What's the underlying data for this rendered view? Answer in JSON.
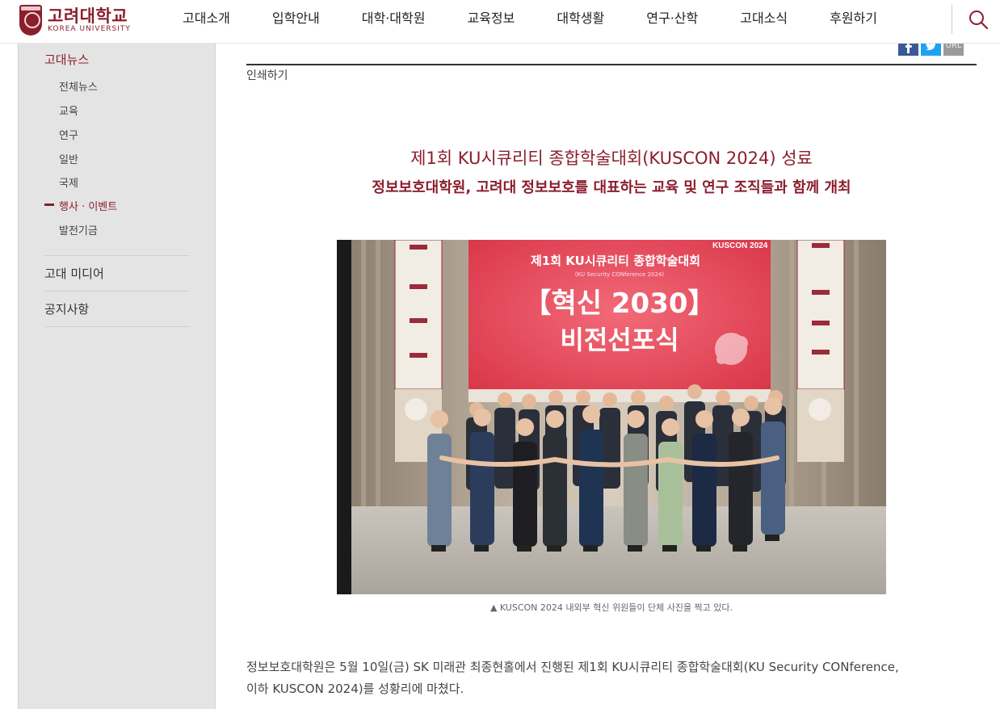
{
  "header": {
    "logo_ko": "고려대학교",
    "logo_en": "KOREA UNIVERSITY",
    "nav": [
      "고대소개",
      "입학안내",
      "대학·대학원",
      "교육정보",
      "대학생활",
      "연구·산학",
      "고대소식",
      "후원하기"
    ],
    "search_icon": "search-icon"
  },
  "sidebar": {
    "heading": "고대뉴스",
    "items": [
      "전체뉴스",
      "교육",
      "연구",
      "일반",
      "국제",
      "행사 · 이벤트",
      "발전기금"
    ],
    "active_item": "행사 · 이벤트",
    "sections": [
      "고대 미디어",
      "공지사항"
    ]
  },
  "article": {
    "print_label": "인쇄하기",
    "share": {
      "url_label": "URL"
    },
    "title": "제1회 KU시큐리티 종합학술대회(KUSCON 2024) 성료",
    "subtitle": "정보보호대학원, 고려대 정보보호를 대표하는 교육 및 연구 조직들과 함께 개최",
    "photo": {
      "screen_title": "제1회 KU시큐리티 종합학술대회",
      "screen_sub": "(KU Security CONference 2024)",
      "screen_brand": "KUSCON 2024",
      "screen_main1": "【혁신 2030】",
      "screen_main2": "비전선포식"
    },
    "caption": "▲ KUSCON 2024 내외부 혁신 위원들이 단체 사진을 찍고 있다.",
    "body_line1": "정보보호대학원은 5월 10일(금) SK 미래관 최종현홀에서 진행된 제1회 KU시큐리티 종합학술대회(KU Security CONference,",
    "body_line2": "이하 KUSCON 2024)를 성황리에 마쳤다."
  },
  "colors": {
    "brand": "#8b1e2d",
    "sidebar_bg": "#e4e4e4",
    "screen_red": "#e8475a"
  }
}
